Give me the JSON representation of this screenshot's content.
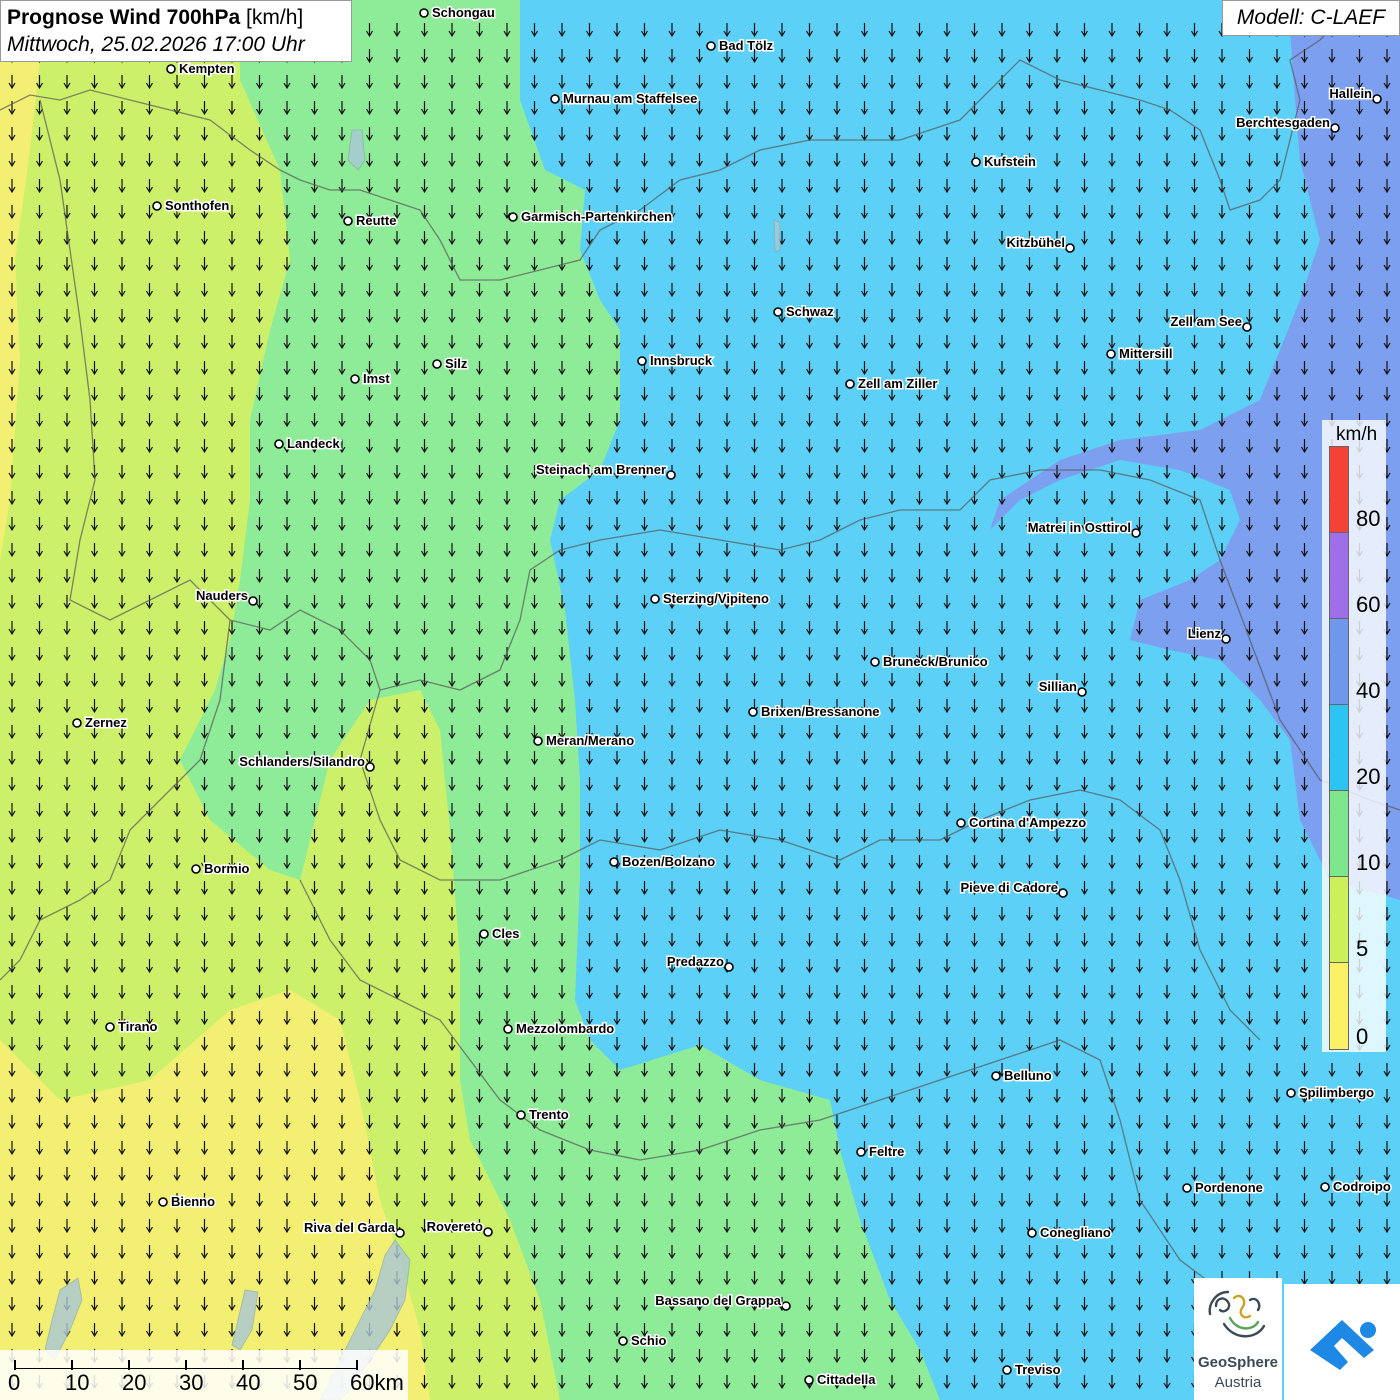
{
  "header": {
    "title_bold": "Prognose Wind 700hPa",
    "title_unit": "[km/h]",
    "datetime": "Mittwoch, 25.02.2026 17:00 Uhr"
  },
  "model": "Modell: C-LAEF",
  "legend": {
    "unit": "km/h",
    "labels": [
      "80",
      "60",
      "40",
      "20",
      "10",
      "5",
      "0"
    ],
    "colors": [
      "#f44336",
      "#a06ee8",
      "#6e98ec",
      "#2cc4f2",
      "#7ee68c",
      "#ccf05a",
      "#fbf066"
    ]
  },
  "scale": {
    "labels": [
      "0",
      "10",
      "20",
      "30",
      "40",
      "50",
      "60km"
    ]
  },
  "logo": {
    "name": "GeoSphere",
    "sub": "Austria"
  },
  "wind_direction": "north",
  "cities": [
    {
      "name": "Schongau",
      "label_side": "right"
    },
    {
      "name": "Bad Tölz",
      "label_side": "right"
    },
    {
      "name": "Kempten",
      "label_side": "right"
    },
    {
      "name": "Hallein",
      "label_side": "left"
    },
    {
      "name": "Murnau am Staffelsee",
      "label_side": "right"
    },
    {
      "name": "Berchtesgaden",
      "label_side": "left"
    },
    {
      "name": "Kufstein",
      "label_side": "right"
    },
    {
      "name": "Sonthofen",
      "label_side": "right"
    },
    {
      "name": "Reutte",
      "label_side": "right"
    },
    {
      "name": "Garmisch-Partenkirchen",
      "label_side": "right"
    },
    {
      "name": "Kitzbühel",
      "label_side": "left"
    },
    {
      "name": "Schwaz",
      "label_side": "right"
    },
    {
      "name": "Zell am See",
      "label_side": "left"
    },
    {
      "name": "Innsbruck",
      "label_side": "right"
    },
    {
      "name": "Mittersill",
      "label_side": "right"
    },
    {
      "name": "Silz",
      "label_side": "right"
    },
    {
      "name": "Imst",
      "label_side": "right"
    },
    {
      "name": "Zell am Ziller",
      "label_side": "right"
    },
    {
      "name": "Landeck",
      "label_side": "right"
    },
    {
      "name": "Steinach am Brenner",
      "label_side": "left"
    },
    {
      "name": "Matrei in Osttirol",
      "label_side": "left"
    },
    {
      "name": "Nauders",
      "label_side": "left"
    },
    {
      "name": "Sterzing/Vipiteno",
      "label_side": "right"
    },
    {
      "name": "Lienz",
      "label_side": "left"
    },
    {
      "name": "Bruneck/Brunico",
      "label_side": "right"
    },
    {
      "name": "Sillian",
      "label_side": "left"
    },
    {
      "name": "Brixen/Bressanone",
      "label_side": "right"
    },
    {
      "name": "Zernez",
      "label_side": "right"
    },
    {
      "name": "Meran/Merano",
      "label_side": "right"
    },
    {
      "name": "Schlanders/Silandro",
      "label_side": "left"
    },
    {
      "name": "Cortina d'Ampezzo",
      "label_side": "right"
    },
    {
      "name": "Bozen/Bolzano",
      "label_side": "right"
    },
    {
      "name": "Bormio",
      "label_side": "right"
    },
    {
      "name": "Pieve di Cadore",
      "label_side": "left"
    },
    {
      "name": "Cles",
      "label_side": "right"
    },
    {
      "name": "Predazzo",
      "label_side": "left"
    },
    {
      "name": "Tirano",
      "label_side": "right"
    },
    {
      "name": "Mezzolombardo",
      "label_side": "right"
    },
    {
      "name": "Belluno",
      "label_side": "right"
    },
    {
      "name": "Spilimbergo",
      "label_side": "right"
    },
    {
      "name": "Trento",
      "label_side": "right"
    },
    {
      "name": "Feltre",
      "label_side": "right"
    },
    {
      "name": "Pordenone",
      "label_side": "right"
    },
    {
      "name": "Codroipo",
      "label_side": "right"
    },
    {
      "name": "Bienno",
      "label_side": "right"
    },
    {
      "name": "Riva del Garda",
      "label_side": "left"
    },
    {
      "name": "Rovereto",
      "label_side": "left"
    },
    {
      "name": "Conegliano",
      "label_side": "right"
    },
    {
      "name": "Bassano del Grappa",
      "label_side": "left"
    },
    {
      "name": "Schio",
      "label_side": "right"
    },
    {
      "name": "Treviso",
      "label_side": "right"
    },
    {
      "name": "Cittadella",
      "label_side": "right"
    }
  ]
}
